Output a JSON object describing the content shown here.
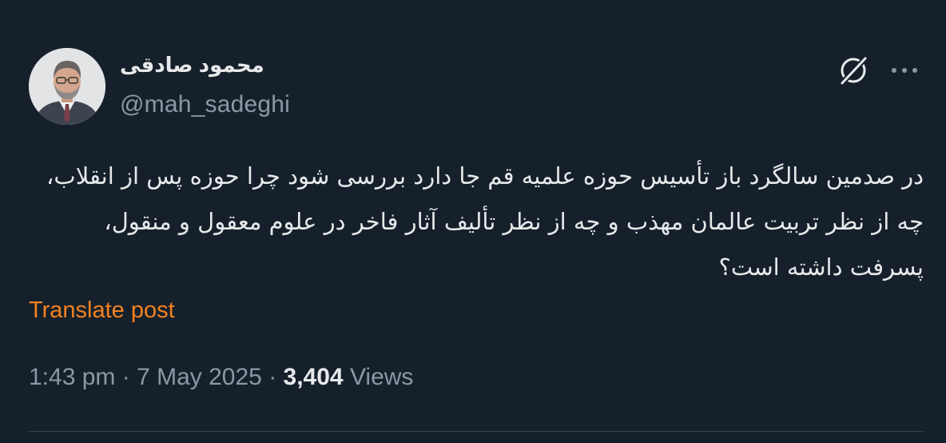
{
  "author": {
    "display_name": "محمود صادقی",
    "handle": "@mah_sadeghi"
  },
  "icons": {
    "grok": "grok-slash-circle-icon",
    "more": "more-dots-icon"
  },
  "post": {
    "text": "در صدمین سالگرد باز تأسیس حوزه علمیه قم جا دارد بررسی شود چرا حوزه پس از انقلاب، چه از نظر تربیت عالمان مهذب و چه از نظر تألیف آثار فاخر در علوم معقول و منقول، پسرفت داشته است؟",
    "translate_label": "Translate post"
  },
  "meta": {
    "time": "1:43 pm",
    "separator": " · ",
    "date": "7 May 2025",
    "views_count": "3,404",
    "views_label": " Views"
  },
  "colors": {
    "background": "#15202b",
    "primary_text": "#e7e9ea",
    "secondary_text": "#8b98a5",
    "translate_link": "#f4821f",
    "divider": "#38444d"
  }
}
